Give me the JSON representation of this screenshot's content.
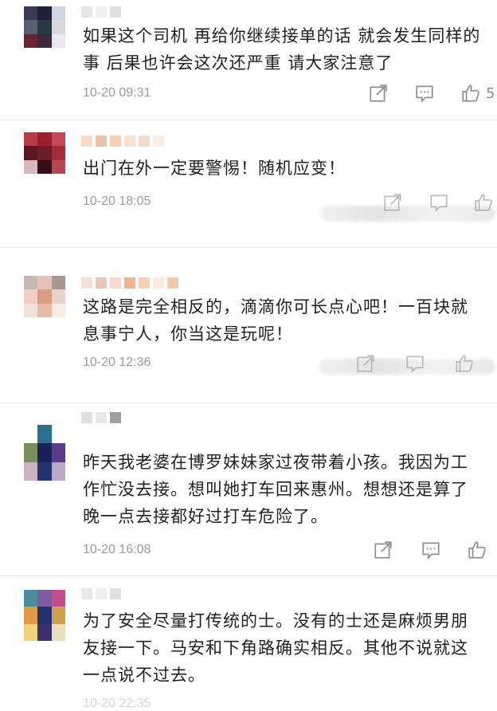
{
  "comments": [
    {
      "text": "如果这个司机 再给你继续接单的话 就会发生同样的事 后果也许会这次还严重 请大家注意了",
      "time": "10-20 09:31",
      "like_count": "5",
      "avatar_colors": [
        "#3a3a52",
        "#1f2138",
        "#cfd6e0",
        "#5a5f6d",
        "#2a3a44",
        "#d7d9df",
        "#6b2432",
        "#3b2a3a",
        "#e8e8ee"
      ],
      "name_colors": [
        "#d8d8d8",
        "#e6e6e6",
        "#d0d0d0"
      ]
    },
    {
      "text": "出门在外一定要警惕！随机应变！",
      "time": "10-20 18:05",
      "like_count": "",
      "avatar_colors": [
        "#b73a4a",
        "#9a1f2f",
        "#c9495a",
        "#5a1a24",
        "#6a1e2a",
        "#a22c3a",
        "#d6b7bd",
        "#3a1018",
        "#b8474f"
      ],
      "name_colors": [
        "#f3c6a6",
        "#e2a17a",
        "#f0b78c",
        "#f5d4b8",
        "#eec6ae",
        "#f7e3d2"
      ]
    },
    {
      "text": "这路是完全相反的，滴滴你可长点心吧！一百块就息事宁人，你当这是玩呢！",
      "time": "10-20 12:36",
      "like_count": "",
      "avatar_colors": [
        "#c9b7b3",
        "#e4c2b7",
        "#a89694",
        "#f1d0c2",
        "#d99b82",
        "#e6d3cb",
        "#f3e1d8",
        "#e8bba6",
        "#f7ece6"
      ],
      "name_colors": [
        "#e8d2c8",
        "#dcaa8e",
        "#f0c9b3",
        "#e78d55",
        "#f3b788",
        "#f6e0cf",
        "#eab07f"
      ]
    },
    {
      "text": "昨天我老婆在博罗妹妹家过夜带着小孩。我因为工作忙没去接。想叫她打车回来惠州。想想还是算了晚一点去接都好过打车危险了。",
      "time": "10-20 16:08",
      "like_count": "",
      "avatar_colors": [
        "#ffffff",
        "#2b6e8f",
        "#ffffff",
        "#7a8f5e",
        "#1b1f5a",
        "#5a3c8a",
        "#c9b3c0",
        "#23316e",
        "#b9a9c7"
      ],
      "name_colors": [
        "#cfcfcf",
        "#dcdcdc",
        "#6a6a6a"
      ]
    },
    {
      "text": "为了安全尽量打传统的士。没有的士还是麻烦男朋友接一下。马安和下角路确实相反。其他不说就这一点说不过去。",
      "time": "10-20 22:35",
      "like_count": "",
      "avatar_colors": [
        "#4a8e9c",
        "#7e5aa0",
        "#c24f8a",
        "#e59a4a",
        "#23316e",
        "#d2a04a",
        "#f2d27a",
        "#3c2f6e",
        "#e8e0b8"
      ],
      "name_colors": [
        "#dcdcdc",
        "#e6e6e6",
        "#cfcfcf"
      ]
    }
  ]
}
